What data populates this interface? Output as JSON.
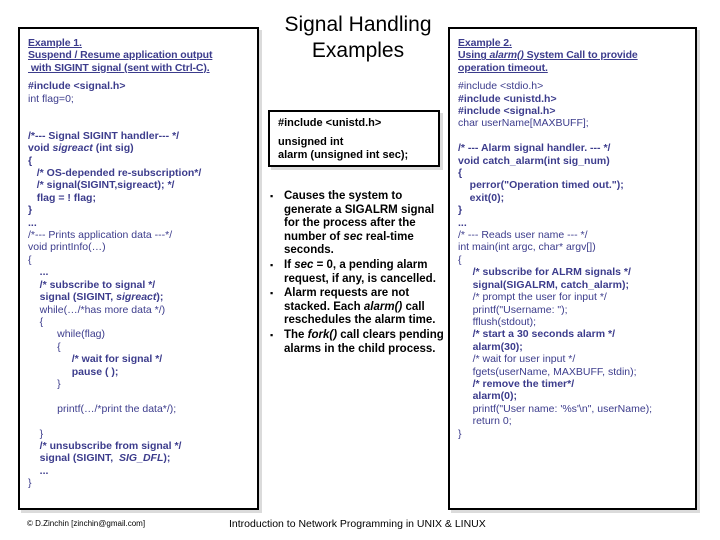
{
  "slide": {
    "title": "Signal Handling Examples"
  },
  "example1": {
    "heading": [
      "Example 1.",
      "Suspend / Resume application output",
      " with SIGINT signal (sent with Ctrl-C)."
    ],
    "code": [
      {
        "text": "#include <signal.h>",
        "style": "bold"
      },
      {
        "text": "int flag=0;",
        "style": "normal"
      },
      {
        "text": "",
        "style": "blank"
      },
      {
        "text": "",
        "style": "blank"
      },
      {
        "text": "/*--- Signal SIGINT handler--- */",
        "style": "bold"
      },
      {
        "text": "void sigreact (int sig)",
        "style": "bold-italic-word",
        "italic_word": "sigreact"
      },
      {
        "text": "{",
        "style": "bold"
      },
      {
        "text": "   /* OS-depended re-subscription*/",
        "style": "bold"
      },
      {
        "text": "   /* signal(SIGINT,sigreact); */",
        "style": "bold"
      },
      {
        "text": "   flag = ! flag;",
        "style": "bold"
      },
      {
        "text": "}",
        "style": "bold"
      },
      {
        "text": "...",
        "style": "bold"
      },
      {
        "text": "/*--- Prints application data ---*/",
        "style": "normal"
      },
      {
        "text": "void printInfo(…)",
        "style": "normal"
      },
      {
        "text": "{",
        "style": "normal"
      },
      {
        "text": "    ...",
        "style": "bold"
      },
      {
        "text": "    /* subscribe to signal */",
        "style": "bold"
      },
      {
        "text": "    signal (SIGINT, sigreact);",
        "style": "bold-italic-word",
        "italic_word": "sigreact"
      },
      {
        "text": "    while(…/*has more data */)",
        "style": "normal"
      },
      {
        "text": "    {",
        "style": "normal"
      },
      {
        "text": "          while(flag)",
        "style": "normal"
      },
      {
        "text": "          {",
        "style": "normal"
      },
      {
        "text": "               /* wait for signal */",
        "style": "bold"
      },
      {
        "text": "               pause ( );",
        "style": "bold"
      },
      {
        "text": "          }",
        "style": "normal"
      },
      {
        "text": "",
        "style": "blank"
      },
      {
        "text": "          printf(…/*print the data*/);",
        "style": "normal"
      },
      {
        "text": "",
        "style": "blank"
      },
      {
        "text": "    }",
        "style": "normal"
      },
      {
        "text": "    /* unsubscribe from signal */",
        "style": "bold"
      },
      {
        "text": "    signal (SIGINT,  SIG_DFL);",
        "style": "bold-italic-word",
        "italic_word": "SIG_DFL"
      },
      {
        "text": "    ...",
        "style": "bold"
      },
      {
        "text": "}",
        "style": "normal"
      }
    ]
  },
  "alarm_def": {
    "lines": [
      "#include <unistd.h>",
      "",
      "unsigned int",
      "alarm (unsigned int sec);"
    ]
  },
  "bullets": [
    {
      "text": "Causes the system to generate a SIGALRM signal for the process after the number of sec real-time seconds.",
      "italic_words": [
        "sec"
      ]
    },
    {
      "text": "If sec = 0, a pending alarm request, if  any, is cancelled.",
      "italic_words": [
        "sec"
      ]
    },
    {
      "text": "Alarm requests are not stacked. Each alarm() call reschedules the alarm time.",
      "italic_words": [
        "alarm()"
      ]
    },
    {
      "text": "The fork() call clears pending alarms in the child process.",
      "italic_words": [
        "fork()"
      ]
    }
  ],
  "example2": {
    "heading": [
      "Example 2.",
      "Using alarm() System Call to provide",
      "operation timeout."
    ],
    "heading_italic_word": "alarm()",
    "code": [
      {
        "text": "#include <stdio.h>",
        "style": "normal"
      },
      {
        "text": "#include <unistd.h>",
        "style": "bold"
      },
      {
        "text": "#include <signal.h>",
        "style": "bold"
      },
      {
        "text": "char userName[MAXBUFF];",
        "style": "normal"
      },
      {
        "text": "",
        "style": "blank"
      },
      {
        "text": "/* --- Alarm signal handler. --- */",
        "style": "bold"
      },
      {
        "text": "void catch_alarm(int sig_num)",
        "style": "bold"
      },
      {
        "text": "{",
        "style": "bold"
      },
      {
        "text": "    perror(\"Operation timed out.\");",
        "style": "bold"
      },
      {
        "text": "    exit(0);",
        "style": "bold"
      },
      {
        "text": "}",
        "style": "bold"
      },
      {
        "text": "...",
        "style": "bold"
      },
      {
        "text": "/* --- Reads user name --- */",
        "style": "normal"
      },
      {
        "text": "int main(int argc, char* argv[])",
        "style": "normal"
      },
      {
        "text": "{",
        "style": "normal"
      },
      {
        "text": "     /* subscribe for ALRM signals */",
        "style": "bold"
      },
      {
        "text": "     signal(SIGALRM, catch_alarm);",
        "style": "bold"
      },
      {
        "text": "     /* prompt the user for input */",
        "style": "normal"
      },
      {
        "text": "     printf(\"Username: \");",
        "style": "normal"
      },
      {
        "text": "     fflush(stdout);",
        "style": "normal"
      },
      {
        "text": "     /* start a 30 seconds alarm */",
        "style": "bold"
      },
      {
        "text": "     alarm(30);",
        "style": "bold"
      },
      {
        "text": "     /* wait for user input */",
        "style": "normal"
      },
      {
        "text": "     fgets(userName, MAXBUFF, stdin);",
        "style": "normal"
      },
      {
        "text": "     /* remove the timer*/",
        "style": "bold"
      },
      {
        "text": "     alarm(0);",
        "style": "bold"
      },
      {
        "text": "     printf(\"User name: '%s'\\n\", userName);",
        "style": "normal"
      },
      {
        "text": "     return 0;",
        "style": "normal"
      },
      {
        "text": "}",
        "style": "normal"
      }
    ]
  },
  "footer": {
    "copyright": "© D.Zinchin [zinchin@gmail.com]",
    "center": "Introduction to Network Programming in UNIX & LINUX"
  }
}
